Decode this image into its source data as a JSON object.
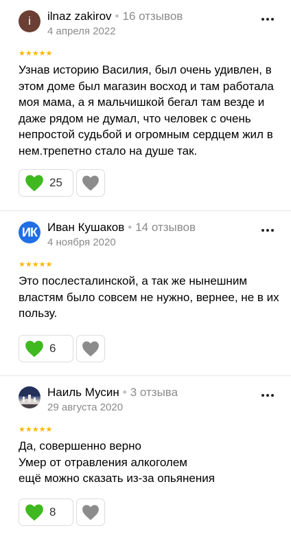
{
  "reviews": [
    {
      "avatar_letter": "i",
      "name": "ilnaz zakirov",
      "reviews_count": "16 отзывов",
      "date": "4 апреля 2022",
      "rating": 5,
      "stars": "★★★★★",
      "text": "Узнав историю Василия, был очень удивлен, в этом доме был магазин восход и там работала моя мама, а я мальчишкой бегал там везде и даже рядом не думал, что человек с очень непростой судьбой и огромным сердцем жил в нем.трепетно стало на душе так.",
      "likes": "25"
    },
    {
      "avatar_letter": "ИК",
      "name": "Иван Кушаков",
      "reviews_count": "14 отзывов",
      "date": "4 ноября 2020",
      "rating": 5,
      "stars": "★★★★★",
      "text": "Это послесталинской, а так же нынешним властям было совсем не нужно, вернее, не в их пользу.",
      "likes": "6"
    },
    {
      "name": "Наиль Мусин",
      "reviews_count": "3 отзыва",
      "date": "29 августа 2020",
      "rating": 5,
      "stars": "★★★★★",
      "text_lines": [
        "Да, совершенно верно",
        "Умер от отравления алкоголем",
        "ещё можно сказать из-за опьянения"
      ],
      "likes": "8"
    }
  ],
  "colors": {
    "star": "#fcb600",
    "like_heart": "#3fb91f",
    "dislike_heart": "#8c8c8c"
  }
}
